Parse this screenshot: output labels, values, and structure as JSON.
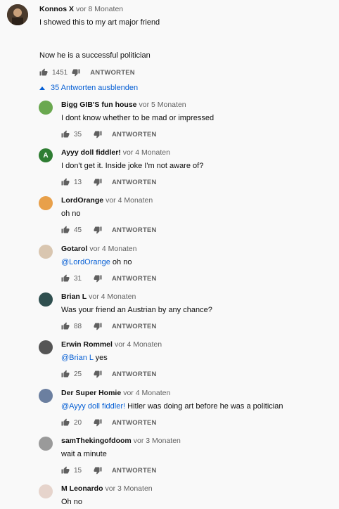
{
  "top_comment": {
    "author": "Konnos X",
    "time": "vor 8 Monaten",
    "line1": "I showed this to my art major friend",
    "line2": "Now he is a successful politician",
    "likes": "1451",
    "reply_label": "ANTWORTEN"
  },
  "replies_toggle": "35 Antworten ausblenden",
  "replies": [
    {
      "author": "Bigg GIB'S fun house",
      "time": "vor 5 Monaten",
      "mention": "",
      "text": "I dont know whether to be mad or impressed",
      "likes": "35",
      "reply_label": "ANTWORTEN",
      "avatar_color": "#6aa84f"
    },
    {
      "author": "Ayyy doll fiddler!",
      "time": "vor 4 Monaten",
      "mention": "",
      "text": "I don't get it. Inside joke I'm not aware of?",
      "likes": "13",
      "reply_label": "ANTWORTEN",
      "avatar_color": "#2e7d32",
      "avatar_letter": "A"
    },
    {
      "author": "LordOrange",
      "time": "vor 4 Monaten",
      "mention": "",
      "text": "oh no",
      "likes": "45",
      "reply_label": "ANTWORTEN",
      "avatar_color": "#e8a04a"
    },
    {
      "author": "Gotarol",
      "time": "vor 4 Monaten",
      "mention": "@LordOrange",
      "text": " oh no",
      "likes": "31",
      "reply_label": "ANTWORTEN",
      "avatar_color": "#d9c6b0"
    },
    {
      "author": "Brian L",
      "time": "vor 4 Monaten",
      "mention": "",
      "text": "Was your friend an Austrian by any chance?",
      "likes": "88",
      "reply_label": "ANTWORTEN",
      "avatar_color": "#2f4f4f"
    },
    {
      "author": "Erwin Rommel",
      "time": "vor 4 Monaten",
      "mention": "@Brian L",
      "text": " yes",
      "likes": "25",
      "reply_label": "ANTWORTEN",
      "avatar_color": "#555555"
    },
    {
      "author": "Der Super Homie",
      "time": "vor 4 Monaten",
      "mention": "@Ayyy doll fiddler!",
      "text": " Hitler was doing art before he was a politician",
      "likes": "20",
      "reply_label": "ANTWORTEN",
      "avatar_color": "#6b7fa0"
    },
    {
      "author": "samThekingofdoom",
      "time": "vor 3 Monaten",
      "mention": "",
      "text": "wait a minute",
      "likes": "15",
      "reply_label": "ANTWORTEN",
      "avatar_color": "#9a9a9a"
    },
    {
      "author": "M Leonardo",
      "time": "vor 3 Monaten",
      "mention": "",
      "text": "Oh no",
      "likes": "",
      "reply_label": "",
      "avatar_color": "#e6d4cc"
    }
  ],
  "colors": {
    "link": "#065fd4",
    "secondary": "#606060",
    "background": "#f9f9f9"
  }
}
